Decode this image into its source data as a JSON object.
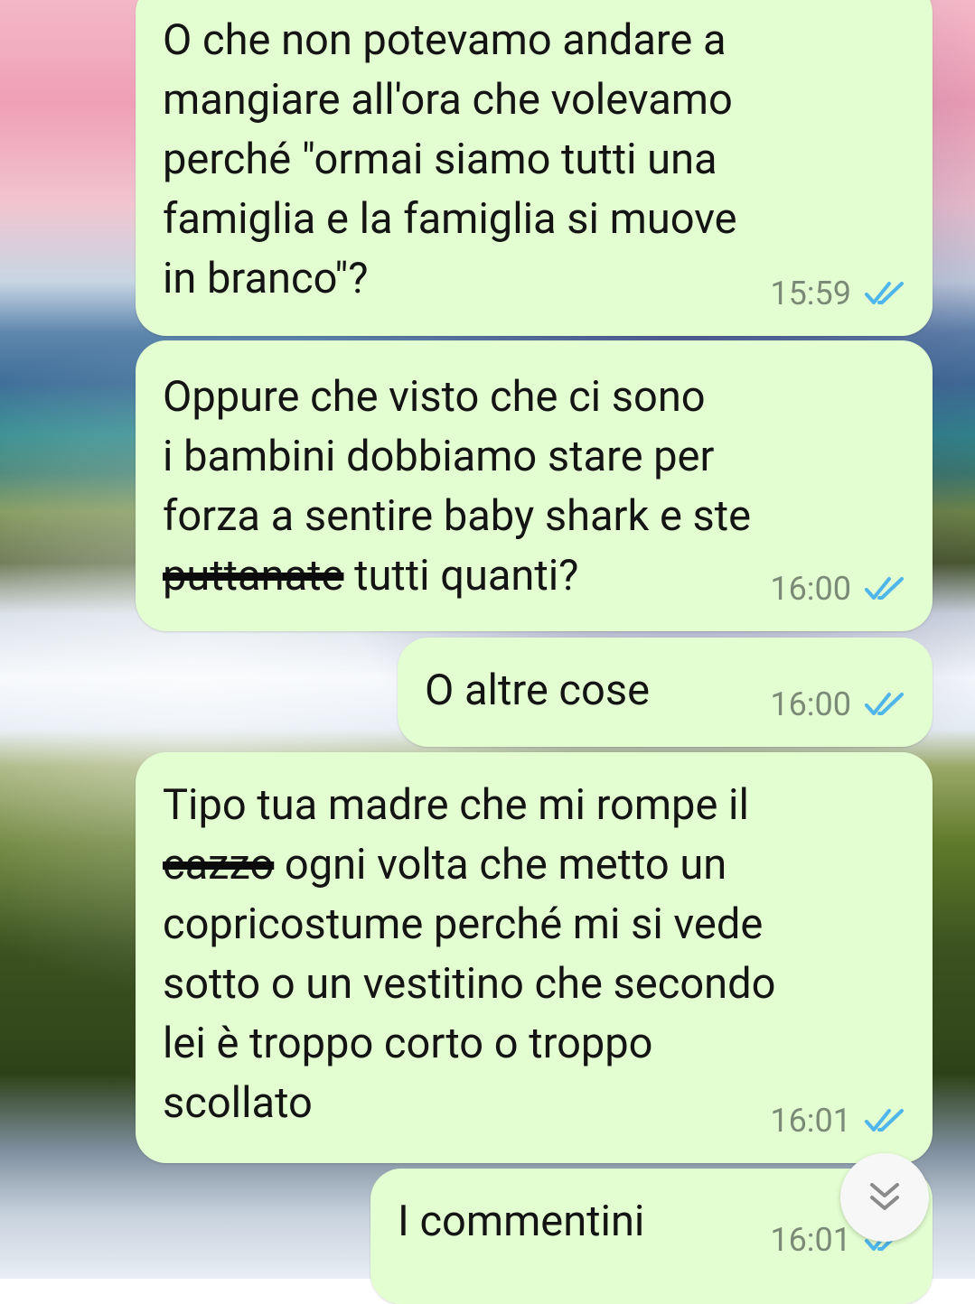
{
  "messages": [
    {
      "parts": [
        {
          "text": "O che non potevamo andare a\nmangiare all'ora che volevamo\nperché \"ormai siamo tutti una\nfamiglia e la famiglia si muove\nin branco\"?",
          "struck": false
        }
      ],
      "time": "15:59"
    },
    {
      "parts": [
        {
          "text": "Oppure che visto che ci sono\ni bambini dobbiamo stare per\nforza a sentire baby shark e ste\n",
          "struck": false
        },
        {
          "text": "puttanate",
          "struck": true
        },
        {
          "text": " tutti quanti?",
          "struck": false
        }
      ],
      "time": "16:00"
    },
    {
      "parts": [
        {
          "text": "O altre cose",
          "struck": false
        }
      ],
      "time": "16:00"
    },
    {
      "parts": [
        {
          "text": "Tipo tua madre che mi rompe il\n",
          "struck": false
        },
        {
          "text": "cazzo",
          "struck": true
        },
        {
          "text": " ogni volta che metto un\ncopricostume perché mi si vede\nsotto o un vestitino che secondo\nlei è troppo corto o troppo\nscollato",
          "struck": false
        }
      ],
      "time": "16:01"
    },
    {
      "parts": [
        {
          "text": "I commentini",
          "struck": false
        }
      ],
      "time": "16:01"
    }
  ],
  "status": "read",
  "icons": {
    "read_receipt": "double-check-icon",
    "scroll": "chevron-double-down-icon"
  },
  "colors": {
    "bubble": "#e3fed1",
    "ticks": "#4fb6ec",
    "time": "#7a8a76"
  }
}
